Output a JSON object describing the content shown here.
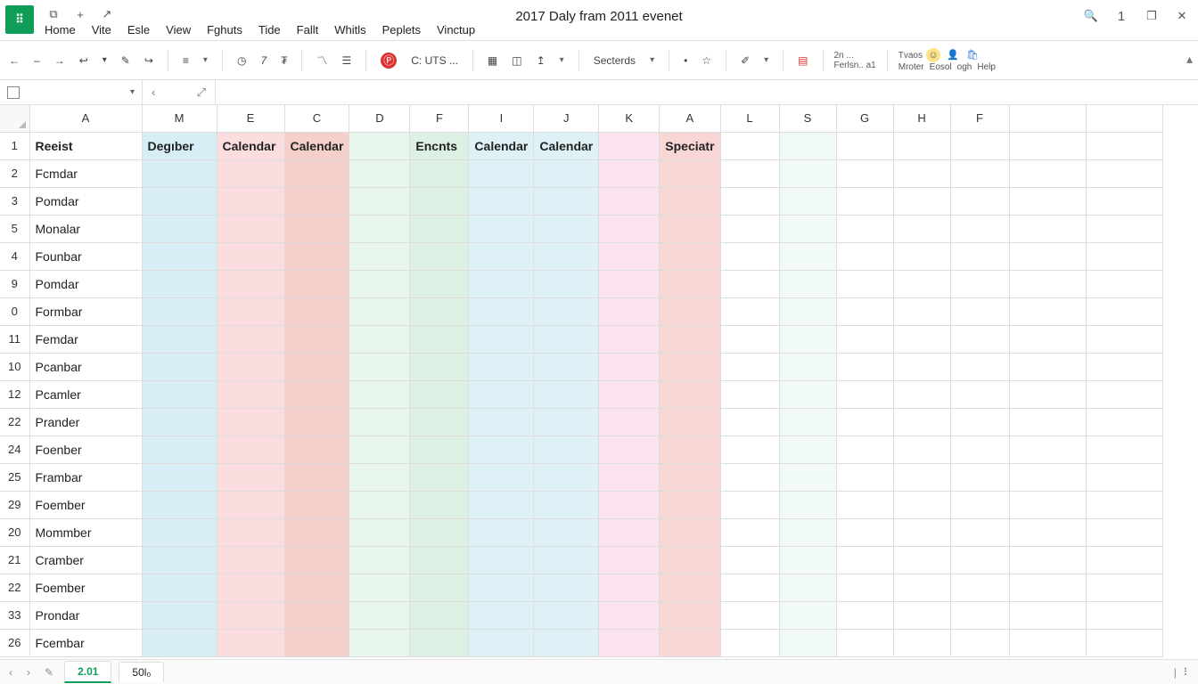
{
  "title": "2017 Daly fram 2011 evenet",
  "menu": {
    "home": "Home",
    "vite": "Vite",
    "esle": "Esle",
    "view": "View",
    "fghuts": "Fghuts",
    "tide": "Tide",
    "fallt": "Fallt",
    "whitls": "Whitls",
    "peplets": "Peplets",
    "vinctup": "Vinctup"
  },
  "toolbar": {
    "uts": "C: UTS ...",
    "secterds": "Secterds",
    "stack1": "2n ...",
    "stack2": "Ferlsn.. a1",
    "stack3": "Tvaos",
    "row2a": "Mroter",
    "row2b": "Eosol",
    "row2c": "ogh",
    "row2d": "Help"
  },
  "columns": [
    "A",
    "M",
    "E",
    "C",
    "D",
    "F",
    "I",
    "J",
    "K",
    "A",
    "L",
    "S",
    "G",
    "H",
    "F",
    "",
    ""
  ],
  "columnClasses": [
    "cA",
    "cM",
    "cE",
    "cC",
    "cD",
    "cF",
    "cI",
    "cJ",
    "cK",
    "cA2",
    "cL",
    "cS",
    "cG",
    "cH",
    "cF2",
    "cX1",
    "cX2"
  ],
  "columnBg": [
    "",
    "bg-blue",
    "bg-pink",
    "bg-salmon",
    "bg-mintL",
    "bg-mint",
    "bg-blue2",
    "bg-blue2",
    "bg-pink2",
    "bg-rose",
    "",
    "bg-mintVL",
    "",
    "",
    "",
    "",
    ""
  ],
  "rowNumbers": [
    "1",
    "2",
    "3",
    "5",
    "4",
    "9",
    "0",
    "11",
    "10",
    "12",
    "22",
    "24",
    "25",
    "29",
    "20",
    "21",
    "22",
    "33",
    "26"
  ],
  "rows": [
    [
      "Reeist",
      "Degıber",
      "Calendar",
      "Calendar",
      "",
      "Encnts",
      "Calendar",
      "Calendar",
      "",
      "Speciatr",
      "",
      "",
      "",
      "",
      "",
      "",
      ""
    ],
    [
      "Fcmdar",
      "",
      "",
      "",
      "",
      "",
      "",
      "",
      "",
      "",
      "",
      "",
      "",
      "",
      "",
      "",
      ""
    ],
    [
      "Pomdar",
      "",
      "",
      "",
      "",
      "",
      "",
      "",
      "",
      "",
      "",
      "",
      "",
      "",
      "",
      "",
      ""
    ],
    [
      "Monalar",
      "",
      "",
      "",
      "",
      "",
      "",
      "",
      "",
      "",
      "",
      "",
      "",
      "",
      "",
      "",
      ""
    ],
    [
      "Founbar",
      "",
      "",
      "",
      "",
      "",
      "",
      "",
      "",
      "",
      "",
      "",
      "",
      "",
      "",
      "",
      ""
    ],
    [
      "Pomdar",
      "",
      "",
      "",
      "",
      "",
      "",
      "",
      "",
      "",
      "",
      "",
      "",
      "",
      "",
      "",
      ""
    ],
    [
      "Formbar",
      "",
      "",
      "",
      "",
      "",
      "",
      "",
      "",
      "",
      "",
      "",
      "",
      "",
      "",
      "",
      ""
    ],
    [
      "Femdar",
      "",
      "",
      "",
      "",
      "",
      "",
      "",
      "",
      "",
      "",
      "",
      "",
      "",
      "",
      "",
      ""
    ],
    [
      "Pcanbar",
      "",
      "",
      "",
      "",
      "",
      "",
      "",
      "",
      "",
      "",
      "",
      "",
      "",
      "",
      "",
      ""
    ],
    [
      "Pcamler",
      "",
      "",
      "",
      "",
      "",
      "",
      "",
      "",
      "",
      "",
      "",
      "",
      "",
      "",
      "",
      ""
    ],
    [
      "Prander",
      "",
      "",
      "",
      "",
      "",
      "",
      "",
      "",
      "",
      "",
      "",
      "",
      "",
      "",
      "",
      ""
    ],
    [
      "Foenber",
      "",
      "",
      "",
      "",
      "",
      "",
      "",
      "",
      "",
      "",
      "",
      "",
      "",
      "",
      "",
      ""
    ],
    [
      "Frambar",
      "",
      "",
      "",
      "",
      "",
      "",
      "",
      "",
      "",
      "",
      "",
      "",
      "",
      "",
      "",
      ""
    ],
    [
      "Foember",
      "",
      "",
      "",
      "",
      "",
      "",
      "",
      "",
      "",
      "",
      "",
      "",
      "",
      "",
      "",
      ""
    ],
    [
      "Mommber",
      "",
      "",
      "",
      "",
      "",
      "",
      "",
      "",
      "",
      "",
      "",
      "",
      "",
      "",
      "",
      ""
    ],
    [
      "Cramber",
      "",
      "",
      "",
      "",
      "",
      "",
      "",
      "",
      "",
      "",
      "",
      "",
      "",
      "",
      "",
      ""
    ],
    [
      "Foember",
      "",
      "",
      "",
      "",
      "",
      "",
      "",
      "",
      "",
      "",
      "",
      "",
      "",
      "",
      "",
      ""
    ],
    [
      "Prondar",
      "",
      "",
      "",
      "",
      "",
      "",
      "",
      "",
      "",
      "",
      "",
      "",
      "",
      "",
      "",
      ""
    ],
    [
      "Fcembar",
      "",
      "",
      "",
      "",
      "",
      "",
      "",
      "",
      "",
      "",
      "",
      "",
      "",
      "",
      "",
      ""
    ]
  ],
  "tabs": {
    "t1": "2.01",
    "t2": "50l₀"
  }
}
